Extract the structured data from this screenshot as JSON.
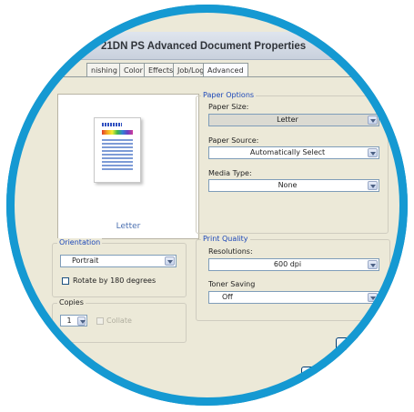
{
  "window": {
    "title": "21DN PS Advanced Document Properties"
  },
  "tabs": [
    "nishing",
    "Color",
    "Effects",
    "Job/Log",
    "Advanced"
  ],
  "preview": {
    "paper_label": "Letter"
  },
  "orientation": {
    "label": "Orientation",
    "value": "Portrait",
    "rotate_label": "Rotate by 180 degrees",
    "rotate_checked": false
  },
  "copies": {
    "label": "Copies",
    "value": "1",
    "collate_label": "Collate"
  },
  "paper_options": {
    "label": "Paper Options",
    "size_label": "Paper Size:",
    "size_value": "Letter",
    "source_label": "Paper Source:",
    "source_value": "Automatically Select",
    "media_label": "Media Type:",
    "media_value": "None"
  },
  "print_quality": {
    "label": "Print Quality",
    "resolution_label": "Resolutions:",
    "resolution_value": "600 dpi",
    "toner_label": "Toner Saving",
    "toner_value": "Off"
  },
  "colors": {
    "frame": "#1599d2",
    "dialog": "#ece9d8",
    "group_label": "#1c47b8"
  }
}
